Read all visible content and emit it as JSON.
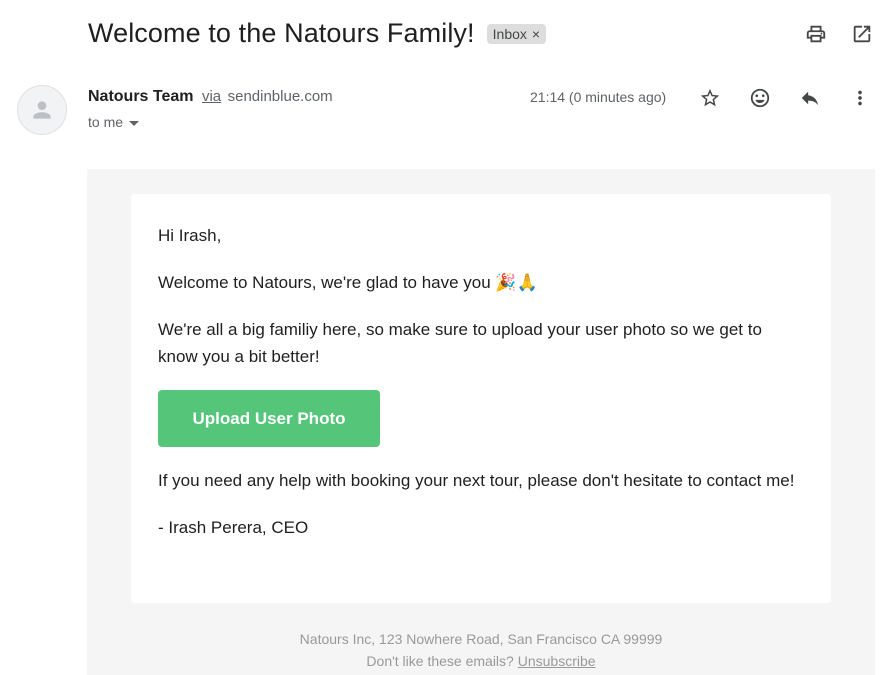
{
  "subject": "Welcome to the Natours Family!",
  "label": {
    "text": "Inbox",
    "close": "×"
  },
  "sender": {
    "name": "Natours Team",
    "via": "via",
    "domain": "sendinblue.com"
  },
  "recipient": {
    "text": "to me"
  },
  "timestamp": "21:14 (0 minutes ago)",
  "icons": {
    "print": "print-icon",
    "open_new": "open-in-new-window-icon",
    "star": "star-icon",
    "emoji": "emoji-icon",
    "reply": "reply-icon",
    "more": "more-vert-icon",
    "avatar": "person-icon"
  },
  "email": {
    "greeting": "Hi Irash,",
    "welcome": "Welcome to Natours, we're glad to have you 🎉🙏",
    "body": "We're all a big familiy here, so make sure to upload your user photo so we get to know you a bit better!",
    "button": "Upload User Photo",
    "help": "If you need any help with booking your next tour, please don't hesitate to contact me!",
    "signature": "- Irash Perera, CEO"
  },
  "footer": {
    "address": "Natours Inc, 123 Nowhere Road, San Francisco CA 99999",
    "question": "Don't like these emails?",
    "unsubscribe": "Unsubscribe"
  },
  "colors": {
    "button": "#55c57a",
    "email_background": "#f5f5f5",
    "label_chip": "#dddddd"
  }
}
